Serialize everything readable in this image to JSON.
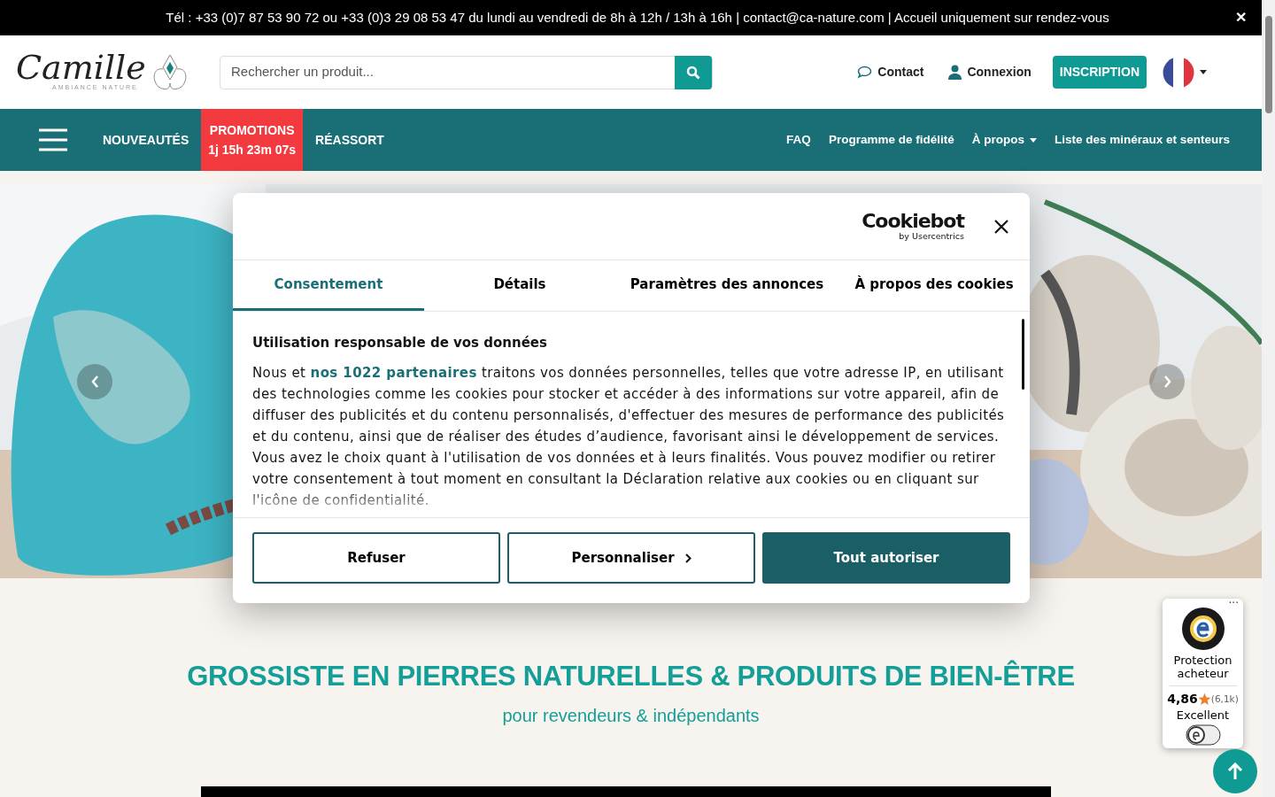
{
  "top_bar": {
    "text": "Tél : +33 (0)7 87 53 90 72 ou +33 (0)3 29 08 53 47 du lundi au vendredi de 8h à 12h / 13h à 16h | contact@ca-nature.com | Accueil uniquement sur rendez-vous",
    "close": "✕"
  },
  "header": {
    "logo": {
      "name": "Camille",
      "tagline": "AMBIANCE NATURE"
    },
    "search": {
      "placeholder": "Rechercher un produit..."
    },
    "contact": "Contact",
    "login": "Connexion",
    "signup": "INSCRIPTION"
  },
  "nav": {
    "left": [
      {
        "kind": "link",
        "label": "NOUVEAUTÉS"
      },
      {
        "kind": "promo",
        "label": "PROMOTIONS",
        "countdown": "1j 15h 23m 07s"
      },
      {
        "kind": "link",
        "label": "RÉASSORT"
      }
    ],
    "right": [
      {
        "label": "FAQ",
        "dropdown": false
      },
      {
        "label": "Programme de fidélité",
        "dropdown": false
      },
      {
        "label": "À propos",
        "dropdown": true
      },
      {
        "label": "Liste des minéraux et senteurs",
        "dropdown": false
      }
    ]
  },
  "cookie_dialog": {
    "brand": "Cookiebot",
    "brand_sub": "by Usercentrics",
    "tabs": [
      {
        "label": "Consentement",
        "selected": true
      },
      {
        "label": "Détails",
        "selected": false
      },
      {
        "label": "Paramètres des annonces",
        "selected": false
      },
      {
        "label": "À propos des cookies",
        "selected": false
      }
    ],
    "heading": "Utilisation responsable de vos données",
    "body_before": "Nous et",
    "link": "nos 1022 partenaires",
    "body_after": "traitons vos données personnelles, telles que votre adresse IP, en utilisant des technologies comme les cookies pour stocker et accéder à des informations sur votre appareil, afin de diffuser des publicités et du contenu personnalisés, d'effectuer des mesures de performance des publicités et du contenu, ainsi que de réaliser des études d’audience, favorisant ainsi le développement de services. Vous avez le choix quant à l'utilisation de vos données et à leurs finalités. Vous pouvez modifier ou retirer votre consentement à tout moment en consultant la Déclaration relative aux cookies ou en cliquant sur l'icône de confidentialité.",
    "buttons": [
      {
        "kind": "outline",
        "label": "Refuser"
      },
      {
        "kind": "outline_chevron",
        "label": "Personnaliser"
      },
      {
        "kind": "primary",
        "label": "Tout autoriser"
      }
    ]
  },
  "headline": {
    "title": "GROSSISTE EN PIERRES NATURELLES & PRODUITS DE BIEN-ÊTRE",
    "subtitle": "pour revendeurs & indépendants"
  },
  "trust_badge": {
    "label": "Protection acheteur",
    "rating": "4,86",
    "count": "(6,1k)",
    "verdict": "Excellent",
    "menu": "···"
  }
}
